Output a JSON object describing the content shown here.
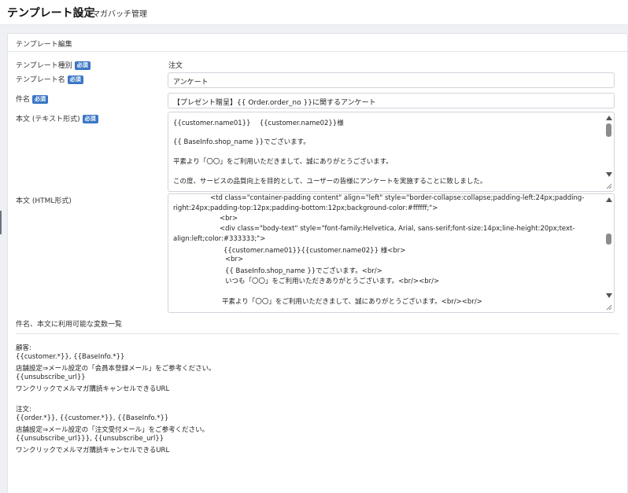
{
  "header": {
    "title": "テンプレート設定",
    "subtitle": "メルマガバッチ管理"
  },
  "panel": {
    "title": "テンプレート編集"
  },
  "form": {
    "required_badge": "必須",
    "template_type": {
      "label": "テンプレート種別",
      "value": "注文"
    },
    "template_name": {
      "label": "テンプレート名",
      "value": "アンケート"
    },
    "subject": {
      "label": "件名",
      "value": "【プレゼント贈呈】{{ Order.order_no }}に関するアンケート"
    },
    "body_text": {
      "label": "本文 (テキスト形式)",
      "lines": [
        "{{customer.name01}}　 {{customer.name02}}様",
        "",
        "{{ BaseInfo.shop_name }}でございます。",
        "",
        "平素より「〇〇」をご利用いただきまして、誠にありがとうございます。",
        "",
        "この度、サービスの品質向上を目的として、ユーザーの皆様にアンケートを実施することに致しました。"
      ]
    },
    "body_html": {
      "label": "本文 (HTML形式)",
      "lines": [
        "<td class=\"container-padding content\" align=\"left\" style=\"border-collapse:collapse;padding-left:24px;padding-",
        "right:24px;padding-top:12px;padding-bottom:12px;background-color:#ffffff;\">",
        "<br>",
        "<div class=\"body-text\" style=\"font-family:Helvetica, Arial, sans-serif;font-size:14px;line-height:20px;text-",
        "align:left;color:#333333;\">",
        "{{customer.name01}}{{customer.name02}} 様<br>",
        "<br>",
        "{{ BaseInfo.shop_name }}でございます。<br/>",
        "いつも「〇〇」をご利用いただきありがとうございます。<br/><br/>",
        "",
        "平素より「〇〇」をご利用いただきまして、誠にありがとうございます。<br/><br/>"
      ]
    }
  },
  "variables": {
    "heading": "件名、本文に利用可能な変数一覧",
    "lines": [
      "顧客:",
      "{{customer.*}}, {{BaseInfo.*}}",
      "店舗設定⇒メール設定の「会員本登録メール」をご参考ください。",
      "{{unsubscribe_url}}",
      "ワンクリックでメルマガ購読キャンセルできるURL",
      "",
      "注文:",
      "{{order.*}}, {{customer.*}}, {{BaseInfo.*}}",
      "店舗設定⇒メール設定の「注文受付メール」をご参考ください。",
      "{{unsubscribe_url}}}, {{unsubscribe_url}}",
      "ワンクリックでメルマガ購読キャンセルできるURL"
    ]
  },
  "icons": {
    "scroll_up": "scroll-up-icon",
    "scroll_down": "scroll-down-icon",
    "resize": "resize-handle-icon"
  },
  "colors": {
    "badge": "#3a76c4",
    "background": "#eef0f4"
  }
}
